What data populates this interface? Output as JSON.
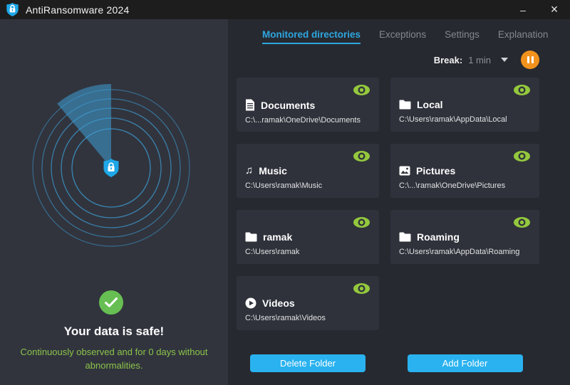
{
  "window": {
    "title": "AntiRansomware 2024"
  },
  "titlebar": {
    "minimize_glyph": "–",
    "close_glyph": "×"
  },
  "tabs": [
    {
      "label": "Monitored directories",
      "active": true
    },
    {
      "label": "Exceptions",
      "active": false
    },
    {
      "label": "Settings",
      "active": false
    },
    {
      "label": "Explanation",
      "active": false
    }
  ],
  "break": {
    "label": "Break:",
    "value": "1 min"
  },
  "cards": [
    {
      "name": "Documents",
      "path": "C:\\...ramak\\OneDrive\\Documents",
      "icon": "document",
      "monitored": true
    },
    {
      "name": "Local",
      "path": "C:\\Users\\ramak\\AppData\\Local",
      "icon": "folder",
      "monitored": true
    },
    {
      "name": "Music",
      "path": "C:\\Users\\ramak\\Music",
      "icon": "music-note",
      "monitored": true
    },
    {
      "name": "Pictures",
      "path": "C:\\...\\ramak\\OneDrive\\Pictures",
      "icon": "picture",
      "monitored": true
    },
    {
      "name": "ramak",
      "path": "C:\\Users\\ramak",
      "icon": "folder",
      "monitored": true
    },
    {
      "name": "Roaming",
      "path": "C:\\Users\\ramak\\AppData\\Roaming",
      "icon": "folder",
      "monitored": true
    },
    {
      "name": "Videos",
      "path": "C:\\Users\\ramak\\Videos",
      "icon": "video-play",
      "monitored": true
    }
  ],
  "buttons": {
    "delete": "Delete Folder",
    "add": "Add Folder"
  },
  "status": {
    "headline": "Your data is safe!",
    "subtext": "Continuously observed and for 0 days without abnormalities."
  },
  "icons": {
    "music_note": "♫"
  },
  "colors": {
    "accent_blue": "#29b2ef",
    "tab_blue": "#2da7e0",
    "eye_green": "#94c83d",
    "check_green": "#67bf53",
    "text_green": "#8bc34a",
    "pause_orange": "#f2921d",
    "shield_blue": "#1ea7e8"
  }
}
